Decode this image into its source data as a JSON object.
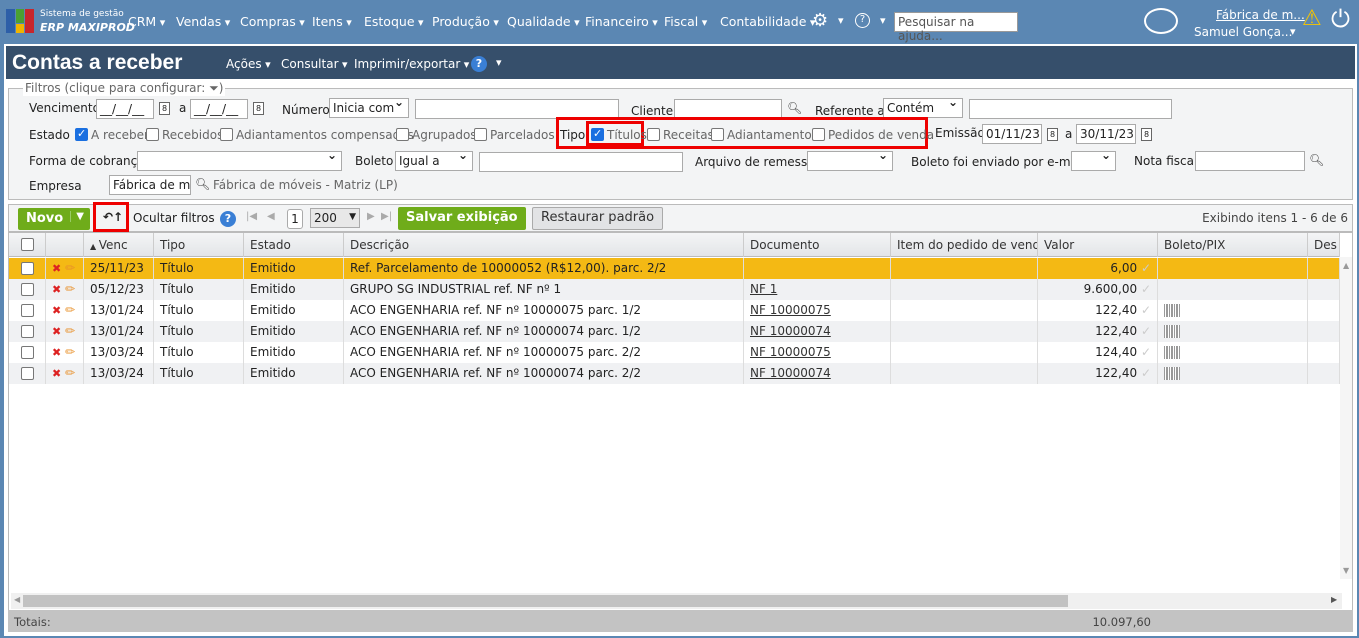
{
  "app": {
    "brand_line1": "Sistema de gestão",
    "brand_line2": "ERP MAXIPROD",
    "company": "Fábrica de m...",
    "user": "Samuel Gonça...",
    "search_placeholder": "Pesquisar na ajuda..."
  },
  "menu": [
    "CRM",
    "Vendas",
    "Compras",
    "Itens",
    "Estoque",
    "Produção",
    "Qualidade",
    "Financeiro",
    "Fiscal",
    "Contabilidade"
  ],
  "page": {
    "title": "Contas a receber",
    "menus": [
      "Ações",
      "Consultar",
      "Imprimir/exportar"
    ]
  },
  "filters": {
    "legend": "Filtros (clique para configurar:",
    "vencimento": "Vencimento",
    "date_empty": "__/__/__",
    "a": "a",
    "numero": "Número",
    "numero_op": "Inicia com",
    "cliente": "Cliente",
    "referente": "Referente a",
    "referente_op": "Contém",
    "estado": "Estado",
    "estado_opts": [
      {
        "label": "A receber",
        "checked": true
      },
      {
        "label": "Recebidos",
        "checked": false
      },
      {
        "label": "Adiantamentos compensados",
        "checked": false
      },
      {
        "label": "Agrupados",
        "checked": false
      },
      {
        "label": "Parcelados",
        "checked": false
      }
    ],
    "tipo": "Tipo",
    "tipo_opts": [
      {
        "label": "Títulos",
        "checked": true
      },
      {
        "label": "Receitas",
        "checked": false
      },
      {
        "label": "Adiantamentos",
        "checked": false
      },
      {
        "label": "Pedidos de venda",
        "checked": false
      }
    ],
    "emissao": "Emissão",
    "emissao_from": "01/11/23",
    "emissao_to": "30/11/23",
    "forma": "Forma de cobrança",
    "boleto": "Boleto",
    "boleto_op": "Igual a",
    "arquivo": "Arquivo de remessa",
    "enviado": "Boleto foi enviado por e-mail",
    "nota": "Nota fiscal",
    "empresa": "Empresa",
    "empresa_value": "Fábrica de móveis -",
    "empresa_name": "Fábrica de móveis - Matriz (LP)"
  },
  "toolbar": {
    "novo": "Novo",
    "ocultar": "Ocultar filtros",
    "page": "1",
    "page_size": "200",
    "salvar": "Salvar exibição",
    "restaurar": "Restaurar padrão",
    "exibindo": "Exibindo itens 1 - 6 de 6"
  },
  "grid": {
    "headers": [
      "Venc",
      "Tipo",
      "Estado",
      "Descrição",
      "Documento",
      "Item do pedido de venda",
      "Valor",
      "Boleto/PIX",
      "Des"
    ],
    "rows": [
      {
        "venc": "25/11/23",
        "tipo": "Título",
        "estado": "Emitido",
        "desc": "Ref. Parcelamento de 10000052 (R$12,00). parc. 2/2",
        "doc": "",
        "item": "",
        "valor": "6,00",
        "boleto": false
      },
      {
        "venc": "05/12/23",
        "tipo": "Título",
        "estado": "Emitido",
        "desc": "GRUPO SG INDUSTRIAL ref. NF nº 1",
        "doc": "NF 1",
        "item": "",
        "valor": "9.600,00",
        "boleto": false
      },
      {
        "venc": "13/01/24",
        "tipo": "Título",
        "estado": "Emitido",
        "desc": "ACO ENGENHARIA ref. NF nº 10000075 parc. 1/2",
        "doc": "NF 10000075",
        "item": "",
        "valor": "122,40",
        "boleto": true
      },
      {
        "venc": "13/01/24",
        "tipo": "Título",
        "estado": "Emitido",
        "desc": "ACO ENGENHARIA ref. NF nº 10000074 parc. 1/2",
        "doc": "NF 10000074",
        "item": "",
        "valor": "122,40",
        "boleto": true
      },
      {
        "venc": "13/03/24",
        "tipo": "Título",
        "estado": "Emitido",
        "desc": "ACO ENGENHARIA ref. NF nº 10000075 parc. 2/2",
        "doc": "NF 10000075",
        "item": "",
        "valor": "124,40",
        "boleto": true
      },
      {
        "venc": "13/03/24",
        "tipo": "Título",
        "estado": "Emitido",
        "desc": "ACO ENGENHARIA ref. NF nº 10000074 parc. 2/2",
        "doc": "NF 10000074",
        "item": "",
        "valor": "122,40",
        "boleto": true
      }
    ],
    "totals_label": "Totais:",
    "totals_value": "10.097,60"
  },
  "colors": {
    "nav": "#5b87b3",
    "titlebar": "#364f6b",
    "selected_row": "#f4b914",
    "green": "#6fac1a"
  }
}
